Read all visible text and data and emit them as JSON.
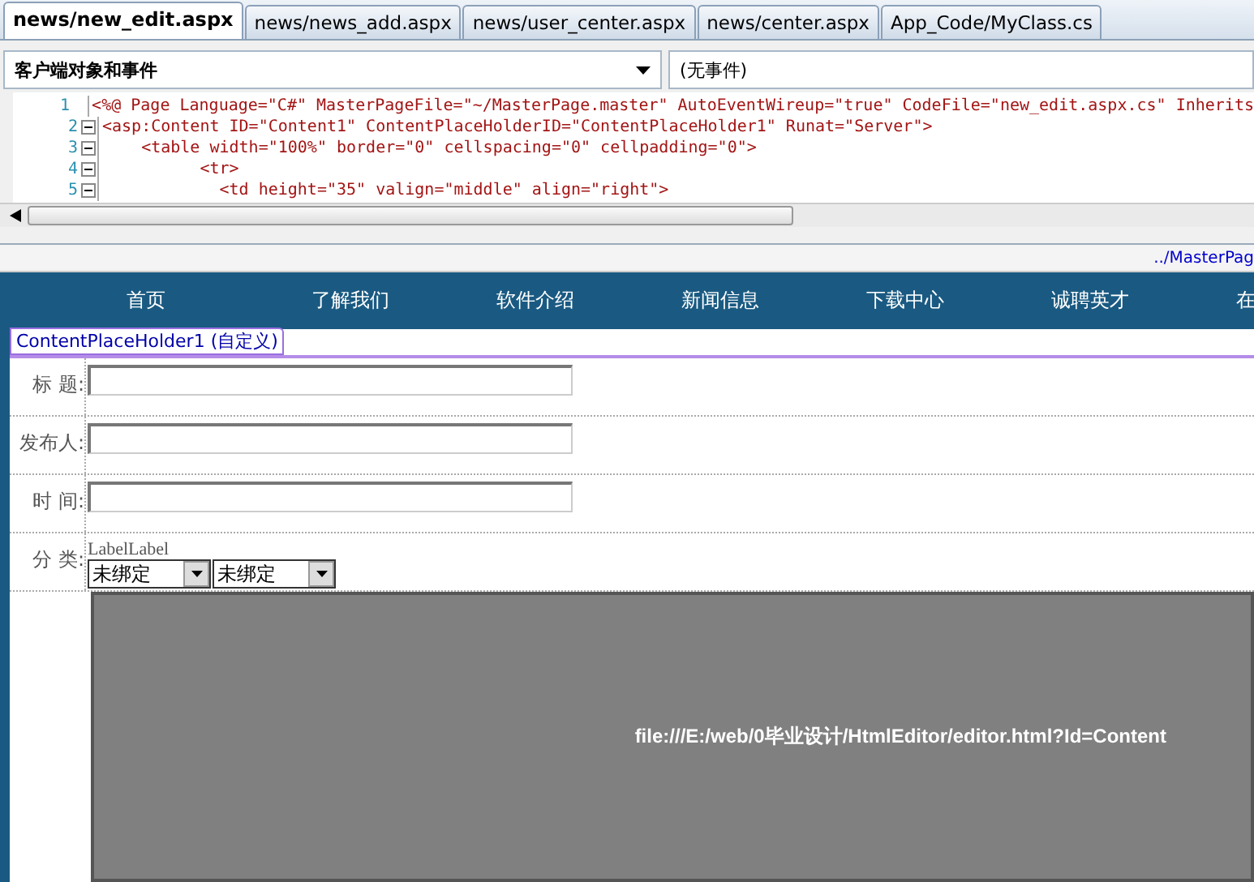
{
  "tabs": [
    {
      "label": "news/new_edit.aspx",
      "selected": true
    },
    {
      "label": "news/news_add.aspx",
      "selected": false
    },
    {
      "label": "news/user_center.aspx",
      "selected": false
    },
    {
      "label": "news/center.aspx",
      "selected": false
    },
    {
      "label": "App_Code/MyClass.cs",
      "selected": false
    }
  ],
  "object_dropdown": "客户端对象和事件",
  "event_dropdown": "(无事件)",
  "code_lines": [
    {
      "number": "1",
      "text": "<%@ Page Language=\"C#\" MasterPageFile=\"~/MasterPage.master\" AutoEventWireup=\"true\" CodeFile=\"new_edit.aspx.cs\" Inherits",
      "foldable": false
    },
    {
      "number": "2",
      "text": "<asp:Content ID=\"Content1\" ContentPlaceHolderID=\"ContentPlaceHolder1\" Runat=\"Server\">",
      "foldable": true
    },
    {
      "number": "3",
      "text": "    <table width=\"100%\" border=\"0\" cellspacing=\"0\" cellpadding=\"0\">",
      "foldable": true
    },
    {
      "number": "4",
      "text": "          <tr>",
      "foldable": true
    },
    {
      "number": "5",
      "text": "            <td height=\"35\" valign=\"middle\" align=\"right\">",
      "foldable": true
    }
  ],
  "master_page_link": "../MasterPag",
  "nav_items": [
    "首页",
    "了解我们",
    "软件介绍",
    "新闻信息",
    "下载中心",
    "诚聘英才",
    "在"
  ],
  "placeholder_tag": "ContentPlaceHolder1 (自定义)",
  "form_rows": [
    {
      "kind": "text",
      "label": "标 题:"
    },
    {
      "kind": "text",
      "label": "发布人:"
    },
    {
      "kind": "text",
      "label": "时 间:"
    },
    {
      "kind": "select",
      "label": "分 类:",
      "caption": "LabelLabel",
      "selects": [
        "未绑定",
        "未绑定"
      ]
    }
  ],
  "editor_frame_url": "file:///E:/web/0毕业设计/HtmlEditor/editor.html?Id=Content"
}
